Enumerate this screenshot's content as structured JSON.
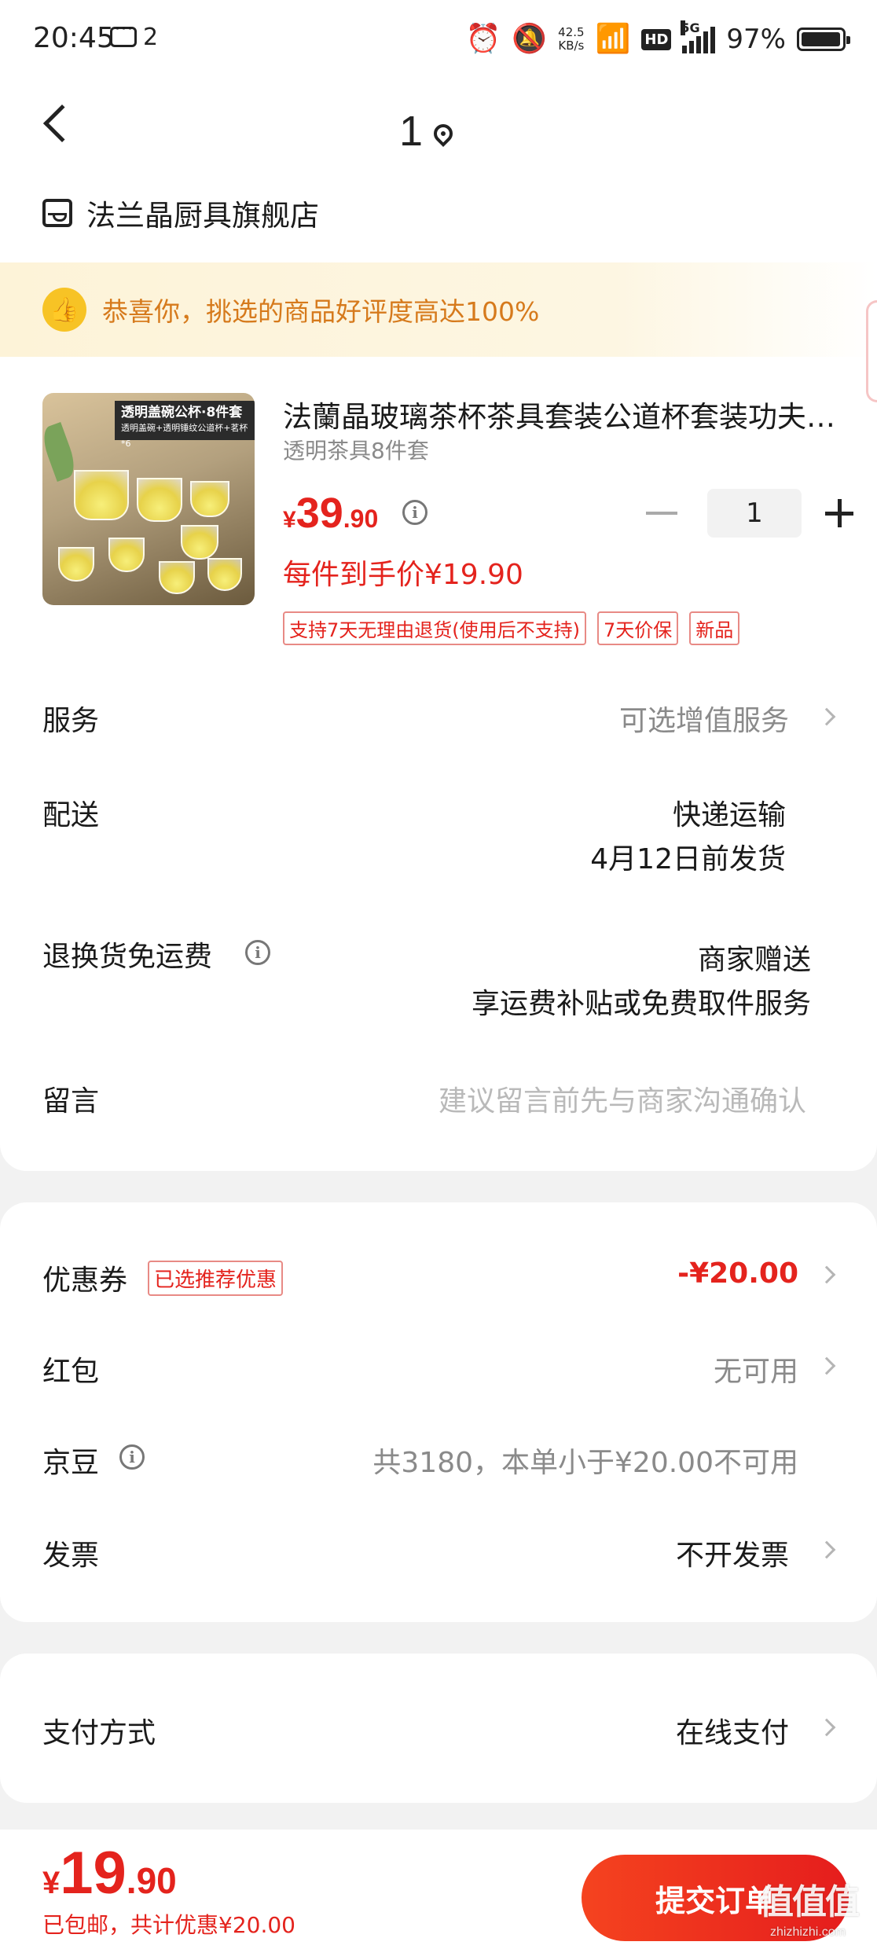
{
  "status_bar": {
    "time": "20:45",
    "notification_count": "2",
    "net_speed_value": "42.5",
    "net_speed_unit": "KB/s",
    "hd_label": "HD",
    "network_type": "5G",
    "battery_percent": "97%",
    "battery_level": 0.97
  },
  "header": {
    "address_number": "1"
  },
  "shop": {
    "name": "法兰晶厨具旗舰店"
  },
  "banner": {
    "text": "恭喜你，挑选的商品好评度高达100%"
  },
  "product": {
    "title": "法蘭晶玻璃茶杯茶具套装公道杯套装功夫茶具",
    "spec": "透明茶具8件套",
    "image_caption_1": "透明盖碗公杯·8件套",
    "image_caption_2": "透明盖碗+透明锤纹公道杯+茗杯*6",
    "price_currency": "¥",
    "price_int": "39",
    "price_dec": ".90",
    "quantity": "1",
    "unit_price_text": "每件到手价¥19.90",
    "tags": [
      "支持7天无理由退货(使用后不支持)",
      "7天价保",
      "新品"
    ]
  },
  "rows": {
    "service": {
      "label": "服务",
      "value": "可选增值服务"
    },
    "delivery": {
      "label": "配送",
      "value_1": "快递运输",
      "value_2": "4月12日前发货"
    },
    "return_shipping": {
      "label": "退换货免运费",
      "value_1": "商家赠送",
      "value_2": "享运费补贴或免费取件服务"
    },
    "message": {
      "label": "留言",
      "placeholder": "建议留言前先与商家沟通确认"
    }
  },
  "discounts": {
    "coupon": {
      "label": "优惠券",
      "tag": "已选推荐优惠",
      "value": "-¥20.00"
    },
    "red_packet": {
      "label": "红包",
      "value": "无可用"
    },
    "jd_beans": {
      "label": "京豆",
      "value": "共3180，本单小于¥20.00不可用"
    },
    "invoice": {
      "label": "发票",
      "value": "不开发票"
    }
  },
  "payment": {
    "label": "支付方式",
    "value": "在线支付"
  },
  "bottom_bar": {
    "total_currency": "¥",
    "total_int": "19",
    "total_dec": ".90",
    "total_sub": "已包邮，共计优惠¥20.00",
    "submit_label": "提交订单",
    "watermark": "值值值",
    "watermark_sub": "zhizhizhi.com"
  },
  "colors": {
    "accent_red": "#e4231d",
    "banner_orange": "#d67a1c",
    "banner_bg": "#fdf3d8"
  }
}
